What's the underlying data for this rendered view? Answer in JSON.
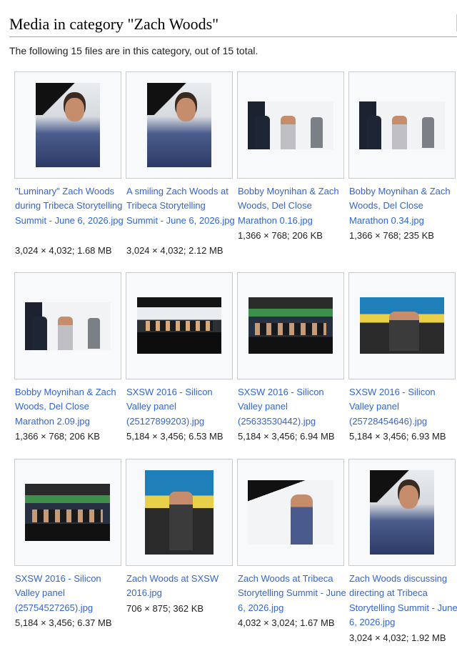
{
  "page": {
    "title": "Media in category \"Zach Woods\"",
    "summary": "The following 15 files are in this category, out of 15 total."
  },
  "files": [
    {
      "caption": "\"Luminary\" Zach Woods during Tribeca Storytelling Summit - June 6, 2026.jpg",
      "dims": "3,024 × 4,032; 1.68 MB"
    },
    {
      "caption": "A smiling Zach Woods at Tribeca Storytelling Summit - June 6, 2026.jpg",
      "dims": "3,024 × 4,032; 2.12 MB"
    },
    {
      "caption": "Bobby Moynihan & Zach Woods, Del Close Marathon 0.16.jpg",
      "dims": "1,366 × 768; 206 KB"
    },
    {
      "caption": "Bobby Moynihan & Zach Woods, Del Close Marathon 0.34.jpg",
      "dims": "1,366 × 768; 235 KB"
    },
    {
      "caption": "Bobby Moynihan & Zach Woods, Del Close Marathon 2.09.jpg",
      "dims": "1,366 × 768; 206 KB"
    },
    {
      "caption": "SXSW 2016 - Silicon Valley panel (25127899203).jpg",
      "dims": "5,184 × 3,456; 6.53 MB"
    },
    {
      "caption": "SXSW 2016 - Silicon Valley panel (25633530442).jpg",
      "dims": "5,184 × 3,456; 6.94 MB"
    },
    {
      "caption": "SXSW 2016 - Silicon Valley panel (25728454646).jpg",
      "dims": "5,184 × 3,456; 6.93 MB"
    },
    {
      "caption": "SXSW 2016 - Silicon Valley panel (25754527265).jpg",
      "dims": "5,184 × 3,456; 6.37 MB"
    },
    {
      "caption": "Zach Woods at SXSW 2016.jpg",
      "dims": "706 × 875; 362 KB"
    },
    {
      "caption": "Zach Woods at Tribeca Storytelling Summit - June 6, 2026.jpg",
      "dims": "4,032 × 3,024; 1.67 MB"
    },
    {
      "caption": "Zach Woods discussing directing at Tribeca Storytelling Summit - June 6, 2026.jpg",
      "dims": "3,024 × 4,032; 1.92 MB"
    }
  ]
}
